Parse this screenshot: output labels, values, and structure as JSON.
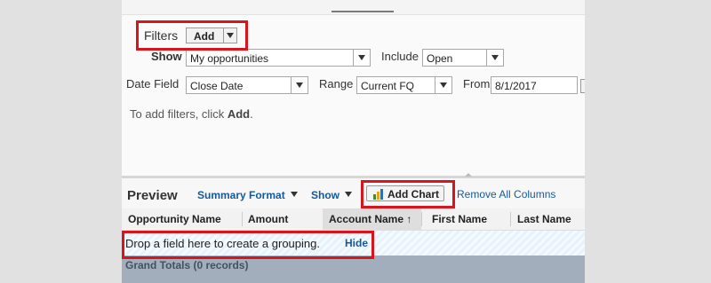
{
  "filters": {
    "title": "Filters",
    "add_label": "Add",
    "show_label": "Show",
    "show_value": "My opportunities",
    "include_label": "Include",
    "include_value": "Open",
    "date_field_label": "Date Field",
    "date_field_value": "Close Date",
    "range_label": "Range",
    "range_value": "Current FQ",
    "from_label": "From",
    "from_value": "8/1/2017",
    "hint_prefix": "To add filters, click ",
    "hint_action": "Add",
    "hint_suffix": "."
  },
  "preview": {
    "title": "Preview",
    "summary_format_label": "Summary Format",
    "show_label": "Show",
    "add_chart_label": "Add Chart",
    "remove_columns_label": "Remove All Columns"
  },
  "columns": [
    {
      "label": "Opportunity Name"
    },
    {
      "label": "Amount"
    },
    {
      "label": "Account Name ↑"
    },
    {
      "label": "First Name"
    },
    {
      "label": "Last Name"
    }
  ],
  "grouping": {
    "drop_text": "Drop a field here to create a grouping.",
    "hide_label": "Hide"
  },
  "totals": {
    "label": "Grand Totals (0 records)"
  },
  "colors": {
    "highlight": "#d8141c",
    "link": "#15599d",
    "totals_bg": "#a2aebc"
  }
}
